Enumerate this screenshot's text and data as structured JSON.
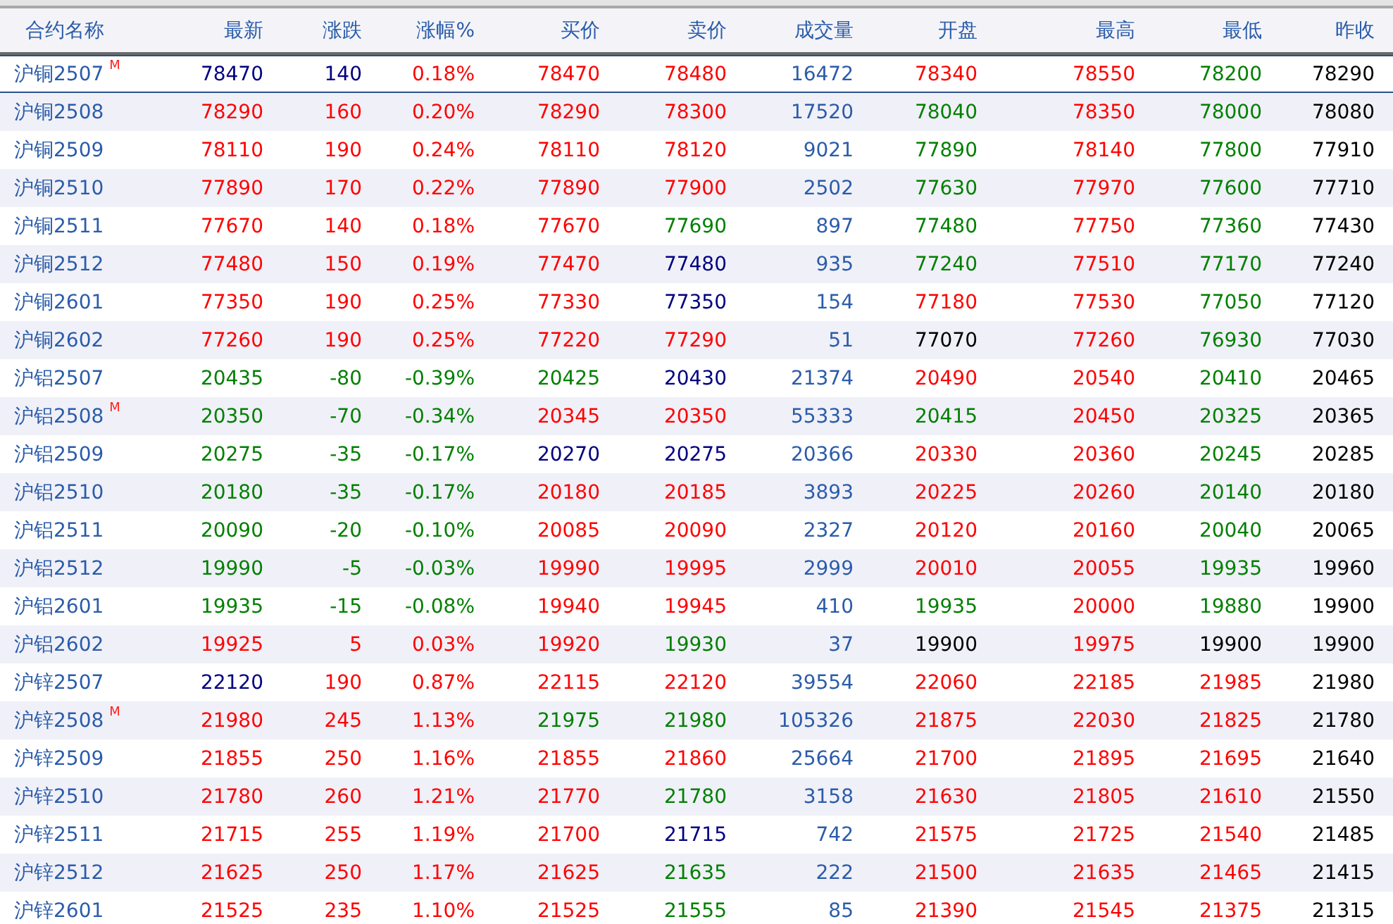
{
  "table": {
    "columns": [
      "合约名称",
      "最新",
      "涨跌",
      "涨幅%",
      "买价",
      "卖价",
      "成交量",
      "开盘",
      "最高",
      "最低",
      "昨收"
    ],
    "rows": [
      {
        "selected": true,
        "cells": [
          {
            "text": "沪铜2507",
            "badge": "M"
          },
          {
            "text": "78470",
            "color": "#000080"
          },
          {
            "text": "140",
            "color": "#000080"
          },
          {
            "text": "0.18%",
            "color": "#ff0000"
          },
          {
            "text": "78470",
            "color": "#ff0000"
          },
          {
            "text": "78480",
            "color": "#ff0000"
          },
          {
            "text": "16472",
            "color": "#2a5caa"
          },
          {
            "text": "78340",
            "color": "#ff0000"
          },
          {
            "text": "78550",
            "color": "#ff0000"
          },
          {
            "text": "78200",
            "color": "#008000"
          },
          {
            "text": "78290",
            "color": "#000000"
          }
        ]
      },
      {
        "selected": false,
        "cells": [
          {
            "text": "沪铜2508"
          },
          {
            "text": "78290",
            "color": "#ff0000"
          },
          {
            "text": "160",
            "color": "#ff0000"
          },
          {
            "text": "0.20%",
            "color": "#ff0000"
          },
          {
            "text": "78290",
            "color": "#ff0000"
          },
          {
            "text": "78300",
            "color": "#ff0000"
          },
          {
            "text": "17520",
            "color": "#2a5caa"
          },
          {
            "text": "78040",
            "color": "#008000"
          },
          {
            "text": "78350",
            "color": "#ff0000"
          },
          {
            "text": "78000",
            "color": "#008000"
          },
          {
            "text": "78080",
            "color": "#000000"
          }
        ]
      },
      {
        "selected": false,
        "cells": [
          {
            "text": "沪铜2509"
          },
          {
            "text": "78110",
            "color": "#ff0000"
          },
          {
            "text": "190",
            "color": "#ff0000"
          },
          {
            "text": "0.24%",
            "color": "#ff0000"
          },
          {
            "text": "78110",
            "color": "#ff0000"
          },
          {
            "text": "78120",
            "color": "#ff0000"
          },
          {
            "text": "9021",
            "color": "#2a5caa"
          },
          {
            "text": "77890",
            "color": "#008000"
          },
          {
            "text": "78140",
            "color": "#ff0000"
          },
          {
            "text": "77800",
            "color": "#008000"
          },
          {
            "text": "77910",
            "color": "#000000"
          }
        ]
      },
      {
        "selected": false,
        "cells": [
          {
            "text": "沪铜2510"
          },
          {
            "text": "77890",
            "color": "#ff0000"
          },
          {
            "text": "170",
            "color": "#ff0000"
          },
          {
            "text": "0.22%",
            "color": "#ff0000"
          },
          {
            "text": "77890",
            "color": "#ff0000"
          },
          {
            "text": "77900",
            "color": "#ff0000"
          },
          {
            "text": "2502",
            "color": "#2a5caa"
          },
          {
            "text": "77630",
            "color": "#008000"
          },
          {
            "text": "77970",
            "color": "#ff0000"
          },
          {
            "text": "77600",
            "color": "#008000"
          },
          {
            "text": "77710",
            "color": "#000000"
          }
        ]
      },
      {
        "selected": false,
        "cells": [
          {
            "text": "沪铜2511"
          },
          {
            "text": "77670",
            "color": "#ff0000"
          },
          {
            "text": "140",
            "color": "#ff0000"
          },
          {
            "text": "0.18%",
            "color": "#ff0000"
          },
          {
            "text": "77670",
            "color": "#ff0000"
          },
          {
            "text": "77690",
            "color": "#008000"
          },
          {
            "text": "897",
            "color": "#2a5caa"
          },
          {
            "text": "77480",
            "color": "#008000"
          },
          {
            "text": "77750",
            "color": "#ff0000"
          },
          {
            "text": "77360",
            "color": "#008000"
          },
          {
            "text": "77430",
            "color": "#000000"
          }
        ]
      },
      {
        "selected": false,
        "cells": [
          {
            "text": "沪铜2512"
          },
          {
            "text": "77480",
            "color": "#ff0000"
          },
          {
            "text": "150",
            "color": "#ff0000"
          },
          {
            "text": "0.19%",
            "color": "#ff0000"
          },
          {
            "text": "77470",
            "color": "#ff0000"
          },
          {
            "text": "77480",
            "color": "#000080"
          },
          {
            "text": "935",
            "color": "#2a5caa"
          },
          {
            "text": "77240",
            "color": "#008000"
          },
          {
            "text": "77510",
            "color": "#ff0000"
          },
          {
            "text": "77170",
            "color": "#008000"
          },
          {
            "text": "77240",
            "color": "#000000"
          }
        ]
      },
      {
        "selected": false,
        "cells": [
          {
            "text": "沪铜2601"
          },
          {
            "text": "77350",
            "color": "#ff0000"
          },
          {
            "text": "190",
            "color": "#ff0000"
          },
          {
            "text": "0.25%",
            "color": "#ff0000"
          },
          {
            "text": "77330",
            "color": "#ff0000"
          },
          {
            "text": "77350",
            "color": "#000080"
          },
          {
            "text": "154",
            "color": "#2a5caa"
          },
          {
            "text": "77180",
            "color": "#ff0000"
          },
          {
            "text": "77530",
            "color": "#ff0000"
          },
          {
            "text": "77050",
            "color": "#008000"
          },
          {
            "text": "77120",
            "color": "#000000"
          }
        ]
      },
      {
        "selected": false,
        "cells": [
          {
            "text": "沪铜2602"
          },
          {
            "text": "77260",
            "color": "#ff0000"
          },
          {
            "text": "190",
            "color": "#ff0000"
          },
          {
            "text": "0.25%",
            "color": "#ff0000"
          },
          {
            "text": "77220",
            "color": "#ff0000"
          },
          {
            "text": "77290",
            "color": "#ff0000"
          },
          {
            "text": "51",
            "color": "#2a5caa"
          },
          {
            "text": "77070",
            "color": "#000000"
          },
          {
            "text": "77260",
            "color": "#ff0000"
          },
          {
            "text": "76930",
            "color": "#008000"
          },
          {
            "text": "77030",
            "color": "#000000"
          }
        ]
      },
      {
        "selected": false,
        "cells": [
          {
            "text": "沪铝2507"
          },
          {
            "text": "20435",
            "color": "#008000"
          },
          {
            "text": "-80",
            "color": "#008000"
          },
          {
            "text": "-0.39%",
            "color": "#008000"
          },
          {
            "text": "20425",
            "color": "#008000"
          },
          {
            "text": "20430",
            "color": "#000080"
          },
          {
            "text": "21374",
            "color": "#2a5caa"
          },
          {
            "text": "20490",
            "color": "#ff0000"
          },
          {
            "text": "20540",
            "color": "#ff0000"
          },
          {
            "text": "20410",
            "color": "#008000"
          },
          {
            "text": "20465",
            "color": "#000000"
          }
        ]
      },
      {
        "selected": false,
        "cells": [
          {
            "text": "沪铝2508",
            "badge": "M"
          },
          {
            "text": "20350",
            "color": "#008000"
          },
          {
            "text": "-70",
            "color": "#008000"
          },
          {
            "text": "-0.34%",
            "color": "#008000"
          },
          {
            "text": "20345",
            "color": "#ff0000"
          },
          {
            "text": "20350",
            "color": "#ff0000"
          },
          {
            "text": "55333",
            "color": "#2a5caa"
          },
          {
            "text": "20415",
            "color": "#008000"
          },
          {
            "text": "20450",
            "color": "#ff0000"
          },
          {
            "text": "20325",
            "color": "#008000"
          },
          {
            "text": "20365",
            "color": "#000000"
          }
        ]
      },
      {
        "selected": false,
        "cells": [
          {
            "text": "沪铝2509"
          },
          {
            "text": "20275",
            "color": "#008000"
          },
          {
            "text": "-35",
            "color": "#008000"
          },
          {
            "text": "-0.17%",
            "color": "#008000"
          },
          {
            "text": "20270",
            "color": "#000080"
          },
          {
            "text": "20275",
            "color": "#000080"
          },
          {
            "text": "20366",
            "color": "#2a5caa"
          },
          {
            "text": "20330",
            "color": "#ff0000"
          },
          {
            "text": "20360",
            "color": "#ff0000"
          },
          {
            "text": "20245",
            "color": "#008000"
          },
          {
            "text": "20285",
            "color": "#000000"
          }
        ]
      },
      {
        "selected": false,
        "cells": [
          {
            "text": "沪铝2510"
          },
          {
            "text": "20180",
            "color": "#008000"
          },
          {
            "text": "-35",
            "color": "#008000"
          },
          {
            "text": "-0.17%",
            "color": "#008000"
          },
          {
            "text": "20180",
            "color": "#ff0000"
          },
          {
            "text": "20185",
            "color": "#ff0000"
          },
          {
            "text": "3893",
            "color": "#2a5caa"
          },
          {
            "text": "20225",
            "color": "#ff0000"
          },
          {
            "text": "20260",
            "color": "#ff0000"
          },
          {
            "text": "20140",
            "color": "#008000"
          },
          {
            "text": "20180",
            "color": "#000000"
          }
        ]
      },
      {
        "selected": false,
        "cells": [
          {
            "text": "沪铝2511"
          },
          {
            "text": "20090",
            "color": "#008000"
          },
          {
            "text": "-20",
            "color": "#008000"
          },
          {
            "text": "-0.10%",
            "color": "#008000"
          },
          {
            "text": "20085",
            "color": "#ff0000"
          },
          {
            "text": "20090",
            "color": "#ff0000"
          },
          {
            "text": "2327",
            "color": "#2a5caa"
          },
          {
            "text": "20120",
            "color": "#ff0000"
          },
          {
            "text": "20160",
            "color": "#ff0000"
          },
          {
            "text": "20040",
            "color": "#008000"
          },
          {
            "text": "20065",
            "color": "#000000"
          }
        ]
      },
      {
        "selected": false,
        "cells": [
          {
            "text": "沪铝2512"
          },
          {
            "text": "19990",
            "color": "#008000"
          },
          {
            "text": "-5",
            "color": "#008000"
          },
          {
            "text": "-0.03%",
            "color": "#008000"
          },
          {
            "text": "19990",
            "color": "#ff0000"
          },
          {
            "text": "19995",
            "color": "#ff0000"
          },
          {
            "text": "2999",
            "color": "#2a5caa"
          },
          {
            "text": "20010",
            "color": "#ff0000"
          },
          {
            "text": "20055",
            "color": "#ff0000"
          },
          {
            "text": "19935",
            "color": "#008000"
          },
          {
            "text": "19960",
            "color": "#000000"
          }
        ]
      },
      {
        "selected": false,
        "cells": [
          {
            "text": "沪铝2601"
          },
          {
            "text": "19935",
            "color": "#008000"
          },
          {
            "text": "-15",
            "color": "#008000"
          },
          {
            "text": "-0.08%",
            "color": "#008000"
          },
          {
            "text": "19940",
            "color": "#ff0000"
          },
          {
            "text": "19945",
            "color": "#ff0000"
          },
          {
            "text": "410",
            "color": "#2a5caa"
          },
          {
            "text": "19935",
            "color": "#008000"
          },
          {
            "text": "20000",
            "color": "#ff0000"
          },
          {
            "text": "19880",
            "color": "#008000"
          },
          {
            "text": "19900",
            "color": "#000000"
          }
        ]
      },
      {
        "selected": false,
        "cells": [
          {
            "text": "沪铝2602"
          },
          {
            "text": "19925",
            "color": "#ff0000"
          },
          {
            "text": "5",
            "color": "#ff0000"
          },
          {
            "text": "0.03%",
            "color": "#ff0000"
          },
          {
            "text": "19920",
            "color": "#ff0000"
          },
          {
            "text": "19930",
            "color": "#008000"
          },
          {
            "text": "37",
            "color": "#2a5caa"
          },
          {
            "text": "19900",
            "color": "#000000"
          },
          {
            "text": "19975",
            "color": "#ff0000"
          },
          {
            "text": "19900",
            "color": "#000000"
          },
          {
            "text": "19900",
            "color": "#000000"
          }
        ]
      },
      {
        "selected": false,
        "cells": [
          {
            "text": "沪锌2507"
          },
          {
            "text": "22120",
            "color": "#000080"
          },
          {
            "text": "190",
            "color": "#ff0000"
          },
          {
            "text": "0.87%",
            "color": "#ff0000"
          },
          {
            "text": "22115",
            "color": "#ff0000"
          },
          {
            "text": "22120",
            "color": "#ff0000"
          },
          {
            "text": "39554",
            "color": "#2a5caa"
          },
          {
            "text": "22060",
            "color": "#ff0000"
          },
          {
            "text": "22185",
            "color": "#ff0000"
          },
          {
            "text": "21985",
            "color": "#ff0000"
          },
          {
            "text": "21980",
            "color": "#000000"
          }
        ]
      },
      {
        "selected": false,
        "cells": [
          {
            "text": "沪锌2508",
            "badge": "M"
          },
          {
            "text": "21980",
            "color": "#ff0000"
          },
          {
            "text": "245",
            "color": "#ff0000"
          },
          {
            "text": "1.13%",
            "color": "#ff0000"
          },
          {
            "text": "21975",
            "color": "#008000"
          },
          {
            "text": "21980",
            "color": "#008000"
          },
          {
            "text": "105326",
            "color": "#2a5caa"
          },
          {
            "text": "21875",
            "color": "#ff0000"
          },
          {
            "text": "22030",
            "color": "#ff0000"
          },
          {
            "text": "21825",
            "color": "#ff0000"
          },
          {
            "text": "21780",
            "color": "#000000"
          }
        ]
      },
      {
        "selected": false,
        "cells": [
          {
            "text": "沪锌2509"
          },
          {
            "text": "21855",
            "color": "#ff0000"
          },
          {
            "text": "250",
            "color": "#ff0000"
          },
          {
            "text": "1.16%",
            "color": "#ff0000"
          },
          {
            "text": "21855",
            "color": "#ff0000"
          },
          {
            "text": "21860",
            "color": "#ff0000"
          },
          {
            "text": "25664",
            "color": "#2a5caa"
          },
          {
            "text": "21700",
            "color": "#ff0000"
          },
          {
            "text": "21895",
            "color": "#ff0000"
          },
          {
            "text": "21695",
            "color": "#ff0000"
          },
          {
            "text": "21640",
            "color": "#000000"
          }
        ]
      },
      {
        "selected": false,
        "cells": [
          {
            "text": "沪锌2510"
          },
          {
            "text": "21780",
            "color": "#ff0000"
          },
          {
            "text": "260",
            "color": "#ff0000"
          },
          {
            "text": "1.21%",
            "color": "#ff0000"
          },
          {
            "text": "21770",
            "color": "#ff0000"
          },
          {
            "text": "21780",
            "color": "#008000"
          },
          {
            "text": "3158",
            "color": "#2a5caa"
          },
          {
            "text": "21630",
            "color": "#ff0000"
          },
          {
            "text": "21805",
            "color": "#ff0000"
          },
          {
            "text": "21610",
            "color": "#ff0000"
          },
          {
            "text": "21550",
            "color": "#000000"
          }
        ]
      },
      {
        "selected": false,
        "cells": [
          {
            "text": "沪锌2511"
          },
          {
            "text": "21715",
            "color": "#ff0000"
          },
          {
            "text": "255",
            "color": "#ff0000"
          },
          {
            "text": "1.19%",
            "color": "#ff0000"
          },
          {
            "text": "21700",
            "color": "#ff0000"
          },
          {
            "text": "21715",
            "color": "#000080"
          },
          {
            "text": "742",
            "color": "#2a5caa"
          },
          {
            "text": "21575",
            "color": "#ff0000"
          },
          {
            "text": "21725",
            "color": "#ff0000"
          },
          {
            "text": "21540",
            "color": "#ff0000"
          },
          {
            "text": "21485",
            "color": "#000000"
          }
        ]
      },
      {
        "selected": false,
        "cells": [
          {
            "text": "沪锌2512"
          },
          {
            "text": "21625",
            "color": "#ff0000"
          },
          {
            "text": "250",
            "color": "#ff0000"
          },
          {
            "text": "1.17%",
            "color": "#ff0000"
          },
          {
            "text": "21625",
            "color": "#ff0000"
          },
          {
            "text": "21635",
            "color": "#008000"
          },
          {
            "text": "222",
            "color": "#2a5caa"
          },
          {
            "text": "21500",
            "color": "#ff0000"
          },
          {
            "text": "21635",
            "color": "#ff0000"
          },
          {
            "text": "21465",
            "color": "#ff0000"
          },
          {
            "text": "21415",
            "color": "#000000"
          }
        ]
      },
      {
        "selected": false,
        "cells": [
          {
            "text": "沪锌2601"
          },
          {
            "text": "21525",
            "color": "#ff0000"
          },
          {
            "text": "235",
            "color": "#ff0000"
          },
          {
            "text": "1.10%",
            "color": "#ff0000"
          },
          {
            "text": "21525",
            "color": "#ff0000"
          },
          {
            "text": "21555",
            "color": "#008000"
          },
          {
            "text": "85",
            "color": "#2a5caa"
          },
          {
            "text": "21390",
            "color": "#ff0000"
          },
          {
            "text": "21545",
            "color": "#ff0000"
          },
          {
            "text": "21375",
            "color": "#ff0000"
          },
          {
            "text": "21315",
            "color": "#000000"
          }
        ]
      }
    ]
  }
}
